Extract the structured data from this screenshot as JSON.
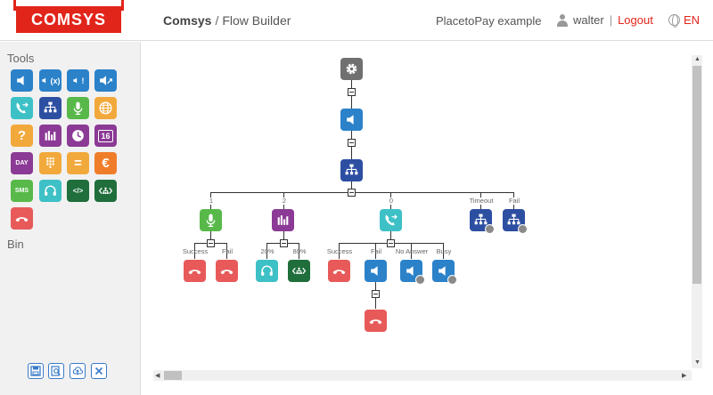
{
  "header": {
    "logo": "COMSYS",
    "app": "Comsys",
    "separator": "/",
    "page": "Flow Builder",
    "project": "PlacetoPay example",
    "user": "walter",
    "pipe": "|",
    "logout": "Logout",
    "language": "EN"
  },
  "sidebar": {
    "tools_title": "Tools",
    "bin_title": "Bin",
    "tools": [
      {
        "icon": "speaker-icon",
        "color": "#2b82c9"
      },
      {
        "icon": "speaker-variable-icon",
        "color": "#2b82c9",
        "glyph": "(x)"
      },
      {
        "icon": "speaker-alert-icon",
        "color": "#2b82c9",
        "glyph": "!"
      },
      {
        "icon": "speaker-link-icon",
        "color": "#2b82c9"
      },
      {
        "icon": "call-transfer-icon",
        "color": "#3ec1c6"
      },
      {
        "icon": "menu-tree-icon",
        "color": "#2d4fa2"
      },
      {
        "icon": "microphone-icon",
        "color": "#58b94a"
      },
      {
        "icon": "globe-icon",
        "color": "#f2a93b"
      },
      {
        "icon": "question-icon",
        "color": "#f2a93b",
        "glyph": "?"
      },
      {
        "icon": "bar-chart-icon",
        "color": "#8b3a95"
      },
      {
        "icon": "clock-icon",
        "color": "#8b3a95"
      },
      {
        "icon": "calendar-icon",
        "color": "#8b3a95",
        "glyph": "16"
      },
      {
        "icon": "day-icon",
        "color": "#8b3a95",
        "glyph": "DAY"
      },
      {
        "icon": "keypad-icon",
        "color": "#f2a93b"
      },
      {
        "icon": "equals-icon",
        "color": "#f2a93b",
        "glyph": "="
      },
      {
        "icon": "euro-icon",
        "color": "#f07d2a",
        "glyph": "€"
      },
      {
        "icon": "sms-icon",
        "color": "#58b94a",
        "glyph": "SMS"
      },
      {
        "icon": "headset-icon",
        "color": "#3ec1c6"
      },
      {
        "icon": "code-icon",
        "color": "#1f6e3b",
        "glyph": "</>"
      },
      {
        "icon": "code-tree-icon",
        "color": "#1f6e3b"
      },
      {
        "icon": "hangup-icon",
        "color": "#e85a5a"
      }
    ],
    "buttons": [
      {
        "name": "save-icon"
      },
      {
        "name": "search-flow-icon"
      },
      {
        "name": "upload-cloud-icon"
      },
      {
        "name": "close-icon"
      }
    ]
  },
  "flow": {
    "branch_labels": [
      "1",
      "2",
      "0",
      "Timeout",
      "Fail"
    ],
    "mic_labels": [
      "Success",
      "Fail"
    ],
    "chart_labels": [
      "20%",
      "80%"
    ],
    "transfer_labels": [
      "Success",
      "Fail",
      "No Answer",
      "Busy"
    ]
  },
  "colors": {
    "gray": "#707070",
    "blue": "#2b82c9",
    "navy": "#2d4fa2",
    "green": "#58b94a",
    "purple": "#8b3a95",
    "teal": "#3ec1c6",
    "red": "#e85a5a",
    "darkgreen": "#1f6e3b",
    "accent": "#e1251b"
  }
}
